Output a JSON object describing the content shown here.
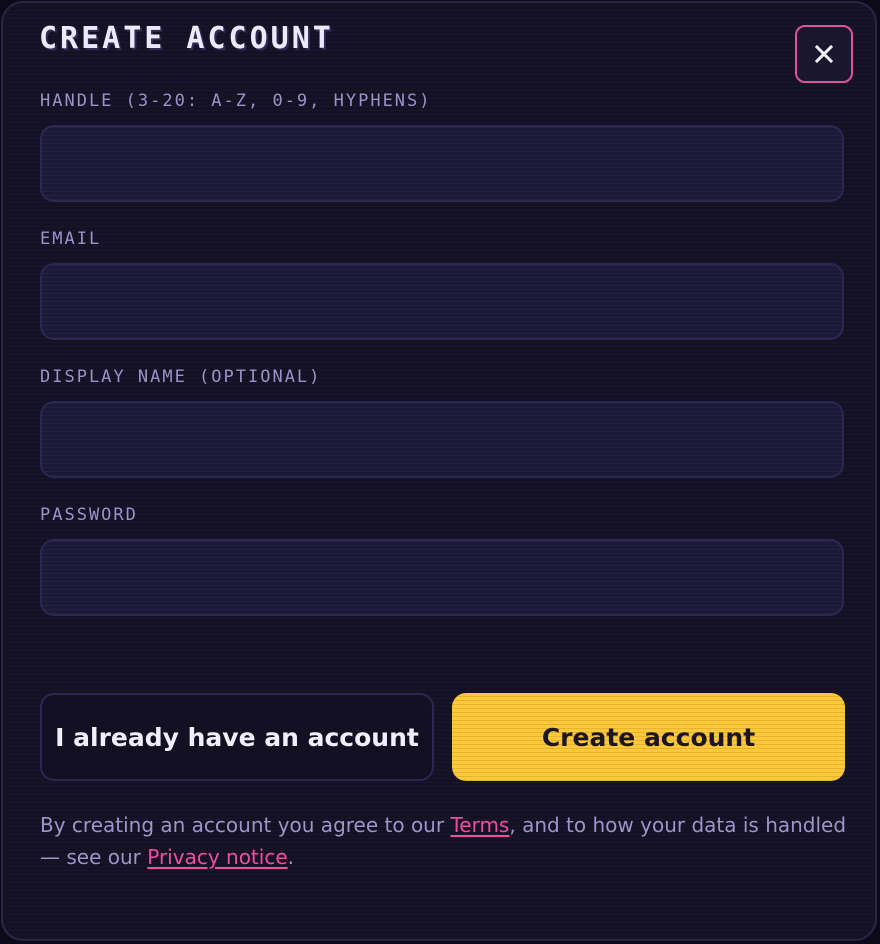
{
  "dialog": {
    "title": "CREATE ACCOUNT",
    "close_icon": "close-icon"
  },
  "form": {
    "handle": {
      "label": "HANDLE (3-20: A-Z, 0-9, HYPHENS)",
      "value": "",
      "placeholder": ""
    },
    "email": {
      "label": "EMAIL",
      "value": "",
      "placeholder": ""
    },
    "display_name": {
      "label": "DISPLAY NAME (OPTIONAL)",
      "value": "",
      "placeholder": ""
    },
    "password": {
      "label": "PASSWORD",
      "value": "",
      "placeholder": ""
    }
  },
  "actions": {
    "secondary_label": "I already have an account",
    "primary_label": "Create account"
  },
  "legal": {
    "prefix": "By creating an account you agree to our ",
    "terms_link": "Terms",
    "middle": ", and to how your data is handled — see our ",
    "privacy_link": "Privacy notice",
    "suffix": "."
  },
  "colors": {
    "accent_pink": "#e0509c",
    "primary_yellow": "#fdc93a",
    "background": "#141125",
    "label": "#9b92c8"
  }
}
